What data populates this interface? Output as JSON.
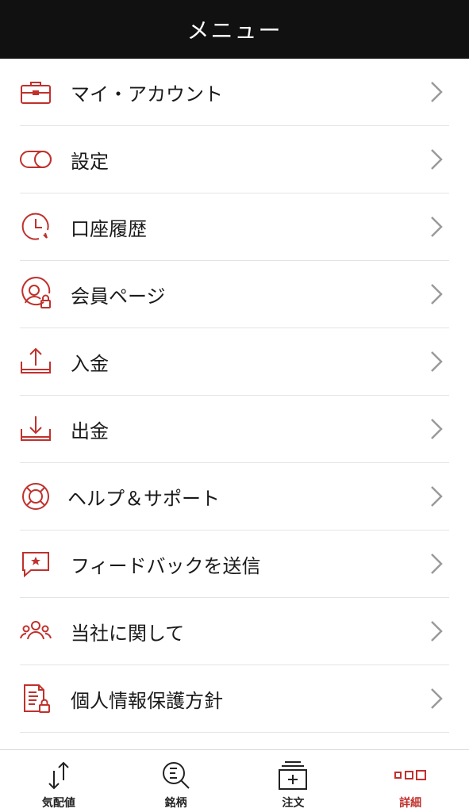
{
  "header": {
    "title": "メニュー"
  },
  "colors": {
    "accent": "#c0312d",
    "header_bg": "#111111",
    "text": "#1a1a1a",
    "chevron": "#9a9a9a"
  },
  "menu": {
    "items": [
      {
        "label": "マイ・アカウント",
        "icon": "briefcase-icon"
      },
      {
        "label": "設定",
        "icon": "toggle-icon"
      },
      {
        "label": "口座履歴",
        "icon": "clock-history-icon"
      },
      {
        "label": "会員ページ",
        "icon": "user-lock-icon"
      },
      {
        "label": "入金",
        "icon": "upload-tray-icon"
      },
      {
        "label": "出金",
        "icon": "download-tray-icon"
      },
      {
        "label": "ヘルプ＆サポート",
        "icon": "lifebuoy-icon"
      },
      {
        "label": "フィードバックを送信",
        "icon": "chat-star-icon"
      },
      {
        "label": "当社に関して",
        "icon": "people-icon"
      },
      {
        "label": "個人情報保護方針",
        "icon": "document-lock-icon"
      }
    ]
  },
  "tabbar": {
    "tabs": [
      {
        "label": "気配値",
        "icon": "arrows-updown-icon"
      },
      {
        "label": "銘柄",
        "icon": "search-list-icon"
      },
      {
        "label": "注文",
        "icon": "order-plus-icon"
      },
      {
        "label": "詳細",
        "icon": "more-squares-icon",
        "active": true
      }
    ]
  }
}
